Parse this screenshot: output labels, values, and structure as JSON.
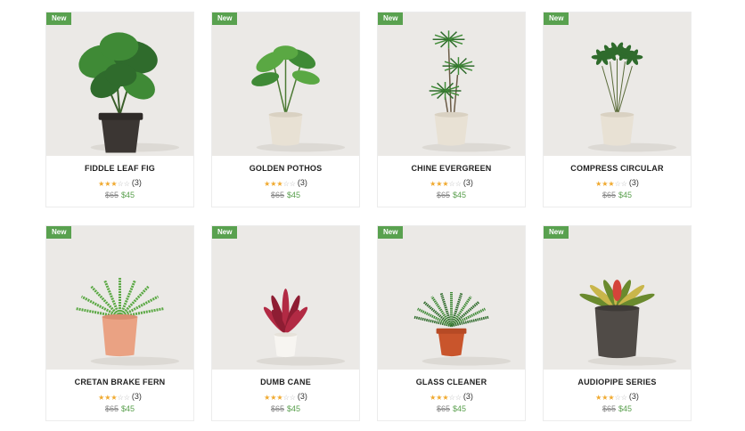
{
  "products": [
    {
      "name": "FIDDLE LEAF FIG",
      "badge": "New",
      "rating": 3,
      "rating_text": "(3)",
      "old_price": "$65",
      "price": "$45",
      "plant": "monstera",
      "pot": "dark"
    },
    {
      "name": "GOLDEN POTHOS",
      "badge": "New",
      "rating": 3,
      "rating_text": "(3)",
      "old_price": "$65",
      "price": "$45",
      "plant": "philodendron",
      "pot": "cream"
    },
    {
      "name": "CHINE EVERGREEN",
      "badge": "New",
      "rating": 3,
      "rating_text": "(3)",
      "old_price": "$65",
      "price": "$45",
      "plant": "dracaena",
      "pot": "cream"
    },
    {
      "name": "COMPRESS CIRCULAR",
      "badge": "New",
      "rating": 3,
      "rating_text": "(3)",
      "old_price": "$65",
      "price": "$45",
      "plant": "schefflera",
      "pot": "cream"
    },
    {
      "name": "CRETAN BRAKE FERN",
      "badge": "New",
      "rating": 3,
      "rating_text": "(3)",
      "old_price": "$65",
      "price": "$45",
      "plant": "fern",
      "pot": "pink"
    },
    {
      "name": "DUMB CANE",
      "badge": "New",
      "rating": 3,
      "rating_text": "(3)",
      "old_price": "$65",
      "price": "$45",
      "plant": "cordyline",
      "pot": "white"
    },
    {
      "name": "GLASS CLEANER",
      "badge": "New",
      "rating": 3,
      "rating_text": "(3)",
      "old_price": "$65",
      "price": "$45",
      "plant": "sago",
      "pot": "terracotta"
    },
    {
      "name": "AUDIOPIPE SERIES",
      "badge": "New",
      "rating": 3,
      "rating_text": "(3)",
      "old_price": "$65",
      "price": "$45",
      "plant": "bromeliad",
      "pot": "stone"
    }
  ],
  "colors": {
    "badge": "#59a14f",
    "star": "#f0a92e",
    "sale_price": "#5aa04e",
    "photo_bg": "#ebe9e6"
  }
}
